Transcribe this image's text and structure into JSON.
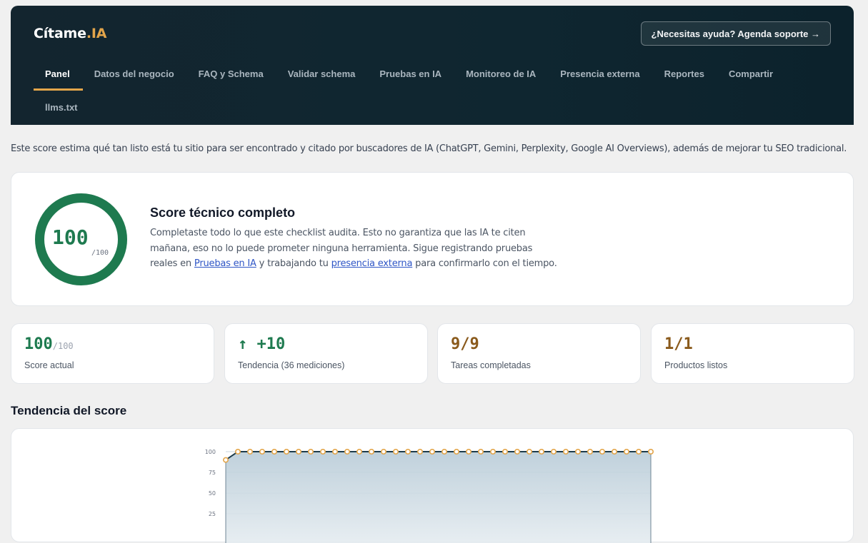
{
  "brand": {
    "name": "Cítame",
    "accent": ".IA"
  },
  "header": {
    "support_label": "¿Necesitas ayuda? Agenda soporte →"
  },
  "nav": {
    "tabs": [
      {
        "label": "Panel",
        "active": true
      },
      {
        "label": "Datos del negocio"
      },
      {
        "label": "FAQ y Schema"
      },
      {
        "label": "Validar schema"
      },
      {
        "label": "Pruebas en IA"
      },
      {
        "label": "Monitoreo de IA"
      },
      {
        "label": "Presencia externa"
      },
      {
        "label": "Reportes"
      },
      {
        "label": "Compartir"
      },
      {
        "label": "llms.txt"
      }
    ]
  },
  "intro": "Este score estima qué tan listo está tu sitio para ser encontrado y citado por buscadores de IA (ChatGPT, Gemini, Perplexity, Google AI Overviews), además de mejorar tu SEO tradicional.",
  "score": {
    "value": "100",
    "max": "/100",
    "progress": 1.0,
    "title": "Score técnico completo",
    "text_a": "Completaste todo lo que este checklist audita. Esto no garantiza que las IA te citen mañana, eso no lo puede prometer ninguna herramienta. Sigue registrando pruebas reales en ",
    "link1": "Pruebas en IA",
    "text_b": " y trabajando tu ",
    "link2": "presencia externa",
    "text_c": " para confirmarlo con el tiempo."
  },
  "stats": [
    {
      "value": "100",
      "max": "/100",
      "label": "Score actual"
    },
    {
      "value": "↑ +10",
      "label": "Tendencia (36 mediciones)"
    },
    {
      "value": "9/9",
      "label": "Tareas completadas"
    },
    {
      "value": "1/1",
      "label": "Productos listos"
    }
  ],
  "trend_title": "Tendencia del score",
  "colors": {
    "accent": "#e3a54a",
    "success": "#1e7a4f",
    "header_bg": "#0f2630",
    "line": "#1d3b4a",
    "point": "#e3a54a"
  },
  "chart_data": {
    "type": "line",
    "y_ticks": [
      "100",
      "75",
      "50",
      "25"
    ],
    "ylim": [
      0,
      100
    ],
    "x": [
      1,
      2,
      3,
      4,
      5,
      6,
      7,
      8,
      9,
      10,
      11,
      12,
      13,
      14,
      15,
      16,
      17,
      18,
      19,
      20,
      21,
      22,
      23,
      24,
      25,
      26,
      27,
      28,
      29,
      30,
      31,
      32,
      33,
      34,
      35,
      36
    ],
    "values": [
      90,
      100,
      100,
      100,
      100,
      100,
      100,
      100,
      100,
      100,
      100,
      100,
      100,
      100,
      100,
      100,
      100,
      100,
      100,
      100,
      100,
      100,
      100,
      100,
      100,
      100,
      100,
      100,
      100,
      100,
      100,
      100,
      100,
      100,
      100,
      100
    ],
    "grid": true,
    "fill": "area"
  }
}
